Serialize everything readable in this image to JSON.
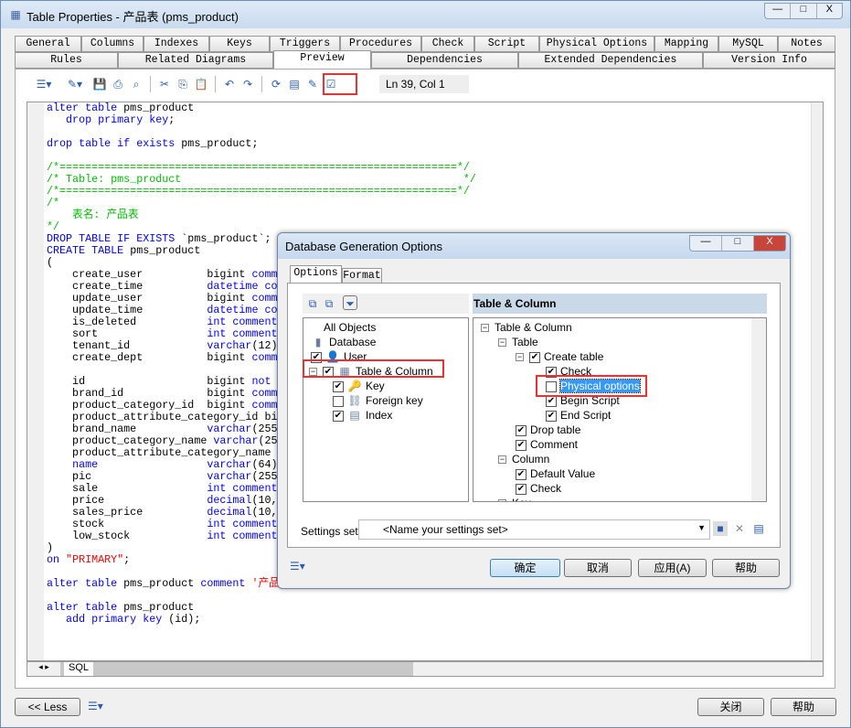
{
  "window": {
    "title": "Table Properties - 产品表 (pms_product)",
    "controls": [
      "—",
      "□",
      "X"
    ]
  },
  "tabs_row1": [
    "General",
    "Columns",
    "Indexes",
    "Keys",
    "Triggers",
    "Procedures",
    "Check",
    "Script",
    "Physical Options",
    "Mapping",
    "MySQL",
    "Notes"
  ],
  "tabs_row2": [
    "Rules",
    "Related Diagrams",
    "Preview",
    "Dependencies",
    "Extended Dependencies",
    "Version Info"
  ],
  "active_tab": "Preview",
  "toolbar": {
    "icons": [
      "script-menu-icon",
      "edit-menu-icon",
      "save-icon",
      "print-icon",
      "find-icon",
      "cut-icon",
      "copy-icon",
      "paste-icon",
      "undo-icon",
      "redo-icon",
      "refresh-icon",
      "properties-icon",
      "change-options-icon",
      "check-icon"
    ],
    "position": "Ln 39, Col 1"
  },
  "code": [
    [
      [
        "kw",
        "alter table "
      ],
      [
        "",
        "pms_product"
      ]
    ],
    [
      [
        "",
        "   "
      ],
      [
        "kw",
        "drop primary key"
      ],
      [
        "",
        ";"
      ]
    ],
    [],
    [
      [
        "kw",
        "drop table if exists "
      ],
      [
        "",
        "pms_product;"
      ]
    ],
    [],
    [
      [
        "cm",
        "/*==============================================================*/"
      ]
    ],
    [
      [
        "cm",
        "/* Table: pms_product                                            */"
      ]
    ],
    [
      [
        "cm",
        "/*==============================================================*/"
      ]
    ],
    [
      [
        "cm",
        "/*"
      ]
    ],
    [
      [
        "cm",
        "    表名: 产品表"
      ]
    ],
    [
      [
        "cm",
        "*/"
      ]
    ],
    [
      [
        "kw",
        "DROP TABLE IF EXISTS "
      ],
      [
        "",
        "`pms_product`;"
      ]
    ],
    [
      [
        "kw",
        "CREATE TABLE "
      ],
      [
        "",
        "pms_product"
      ]
    ],
    [
      [
        "",
        "("
      ]
    ],
    [
      [
        "",
        "    create_user          bigint "
      ],
      [
        "kw",
        "comm"
      ]
    ],
    [
      [
        "",
        "    create_time          "
      ],
      [
        "kw",
        "datetime co"
      ]
    ],
    [
      [
        "",
        "    update_user          bigint "
      ],
      [
        "kw",
        "comm"
      ]
    ],
    [
      [
        "",
        "    update_time          "
      ],
      [
        "kw",
        "datetime co"
      ]
    ],
    [
      [
        "",
        "    is_deleted           "
      ],
      [
        "kw",
        "int comment"
      ]
    ],
    [
      [
        "",
        "    sort                 "
      ],
      [
        "kw",
        "int comment"
      ]
    ],
    [
      [
        "",
        "    tenant_id            "
      ],
      [
        "kw",
        "varchar"
      ],
      [
        "",
        "(12)"
      ]
    ],
    [
      [
        "",
        "    create_dept          bigint "
      ],
      [
        "kw",
        "comm"
      ]
    ],
    [],
    [
      [
        "",
        "    id                   bigint "
      ],
      [
        "kw",
        "not"
      ]
    ],
    [
      [
        "",
        "    brand_id             bigint "
      ],
      [
        "kw",
        "comm"
      ]
    ],
    [
      [
        "",
        "    product_category_id  bigint "
      ],
      [
        "kw",
        "comm"
      ]
    ],
    [
      [
        "",
        "    product_attribute_category_id bi"
      ]
    ],
    [
      [
        "",
        "    brand_name           "
      ],
      [
        "kw",
        "varchar"
      ],
      [
        "",
        "(255"
      ]
    ],
    [
      [
        "",
        "    product_category_name "
      ],
      [
        "kw",
        "varchar"
      ],
      [
        "",
        "(25"
      ]
    ],
    [
      [
        "",
        "    product_attribute_category_name"
      ]
    ],
    [
      [
        "",
        "    "
      ],
      [
        "kw",
        "name                 varchar"
      ],
      [
        "",
        "(64)"
      ]
    ],
    [
      [
        "",
        "    pic                  "
      ],
      [
        "kw",
        "varchar"
      ],
      [
        "",
        "(255"
      ]
    ],
    [
      [
        "",
        "    sale                 "
      ],
      [
        "kw",
        "int comment"
      ]
    ],
    [
      [
        "",
        "    price                "
      ],
      [
        "kw",
        "decimal"
      ],
      [
        "",
        "(10,"
      ]
    ],
    [
      [
        "",
        "    sales_price          "
      ],
      [
        "kw",
        "decimal"
      ],
      [
        "",
        "(10,"
      ]
    ],
    [
      [
        "",
        "    stock                "
      ],
      [
        "kw",
        "int comment"
      ]
    ],
    [
      [
        "",
        "    low_stock            "
      ],
      [
        "kw",
        "int comment"
      ]
    ],
    [
      [
        "",
        ")"
      ]
    ],
    [
      [
        "kw",
        "on "
      ],
      [
        "st",
        "\"PRIMARY\""
      ],
      [
        "",
        ";"
      ]
    ],
    [],
    [
      [
        "kw",
        "alter table "
      ],
      [
        "",
        "pms_product "
      ],
      [
        "kw",
        "comment "
      ],
      [
        "st",
        "'产品"
      ]
    ],
    [],
    [
      [
        "kw",
        "alter table "
      ],
      [
        "",
        "pms_product"
      ]
    ],
    [
      [
        "",
        "   "
      ],
      [
        "kw",
        "add primary key "
      ],
      [
        "",
        "(id);"
      ]
    ]
  ],
  "editor_tabs": [
    "SQL"
  ],
  "dialog": {
    "title": "Database Generation Options",
    "tabs": [
      "Options",
      "Format"
    ],
    "left_tree": [
      {
        "label": "All Objects",
        "checkbox": null
      },
      {
        "label": "Database",
        "checkbox": null
      },
      {
        "label": "User",
        "checkbox": true
      },
      {
        "label": "Table & Column",
        "checkbox": true
      },
      {
        "label": "Key",
        "checkbox": true
      },
      {
        "label": "Foreign key",
        "checkbox": false
      },
      {
        "label": "Index",
        "checkbox": true
      }
    ],
    "right_header": "Table & Column",
    "right_tree": [
      {
        "label": "Table & Column",
        "checkbox": null,
        "level": 0
      },
      {
        "label": "Table",
        "checkbox": null,
        "level": 1
      },
      {
        "label": "Create table",
        "checkbox": true,
        "level": 2
      },
      {
        "label": "Check",
        "checkbox": true,
        "level": 3
      },
      {
        "label": "Physical options",
        "checkbox": false,
        "level": 3,
        "selected": true
      },
      {
        "label": "Begin Script",
        "checkbox": true,
        "level": 3
      },
      {
        "label": "End Script",
        "checkbox": true,
        "level": 3
      },
      {
        "label": "Drop table",
        "checkbox": true,
        "level": 2
      },
      {
        "label": "Comment",
        "checkbox": true,
        "level": 2
      },
      {
        "label": "Column",
        "checkbox": null,
        "level": 1
      },
      {
        "label": "Default Value",
        "checkbox": true,
        "level": 2
      },
      {
        "label": "Check",
        "checkbox": true,
        "level": 2
      },
      {
        "label": "Key",
        "checkbox": null,
        "level": 1
      }
    ],
    "settings_label": "Settings set:",
    "settings_value": "<Name your settings set>",
    "buttons": {
      "ok": "确定",
      "cancel": "取消",
      "apply": "应用(A)",
      "help": "帮助"
    }
  },
  "footer": {
    "less": "<< Less",
    "close": "关闭",
    "help": "帮助"
  },
  "colors": {
    "keyword": "#0000ff",
    "comment": "#00c000",
    "string": "#ff0000",
    "selection": "#3399ff",
    "highlight": "#f03030"
  }
}
